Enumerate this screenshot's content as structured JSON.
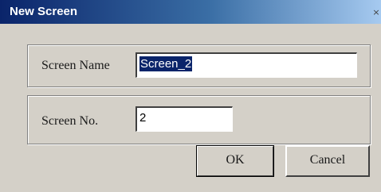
{
  "window": {
    "title": "New Screen",
    "close_glyph": "×"
  },
  "screen_name": {
    "label": "Screen Name",
    "value": "Screen_2"
  },
  "screen_no": {
    "label": "Screen No.",
    "value": "2"
  },
  "buttons": {
    "ok_label": "OK",
    "cancel_label": "Cancel"
  },
  "colors": {
    "title_bar": "#0a246a",
    "dialog_bg": "#d4d0c8",
    "selection": "#0a246a"
  }
}
